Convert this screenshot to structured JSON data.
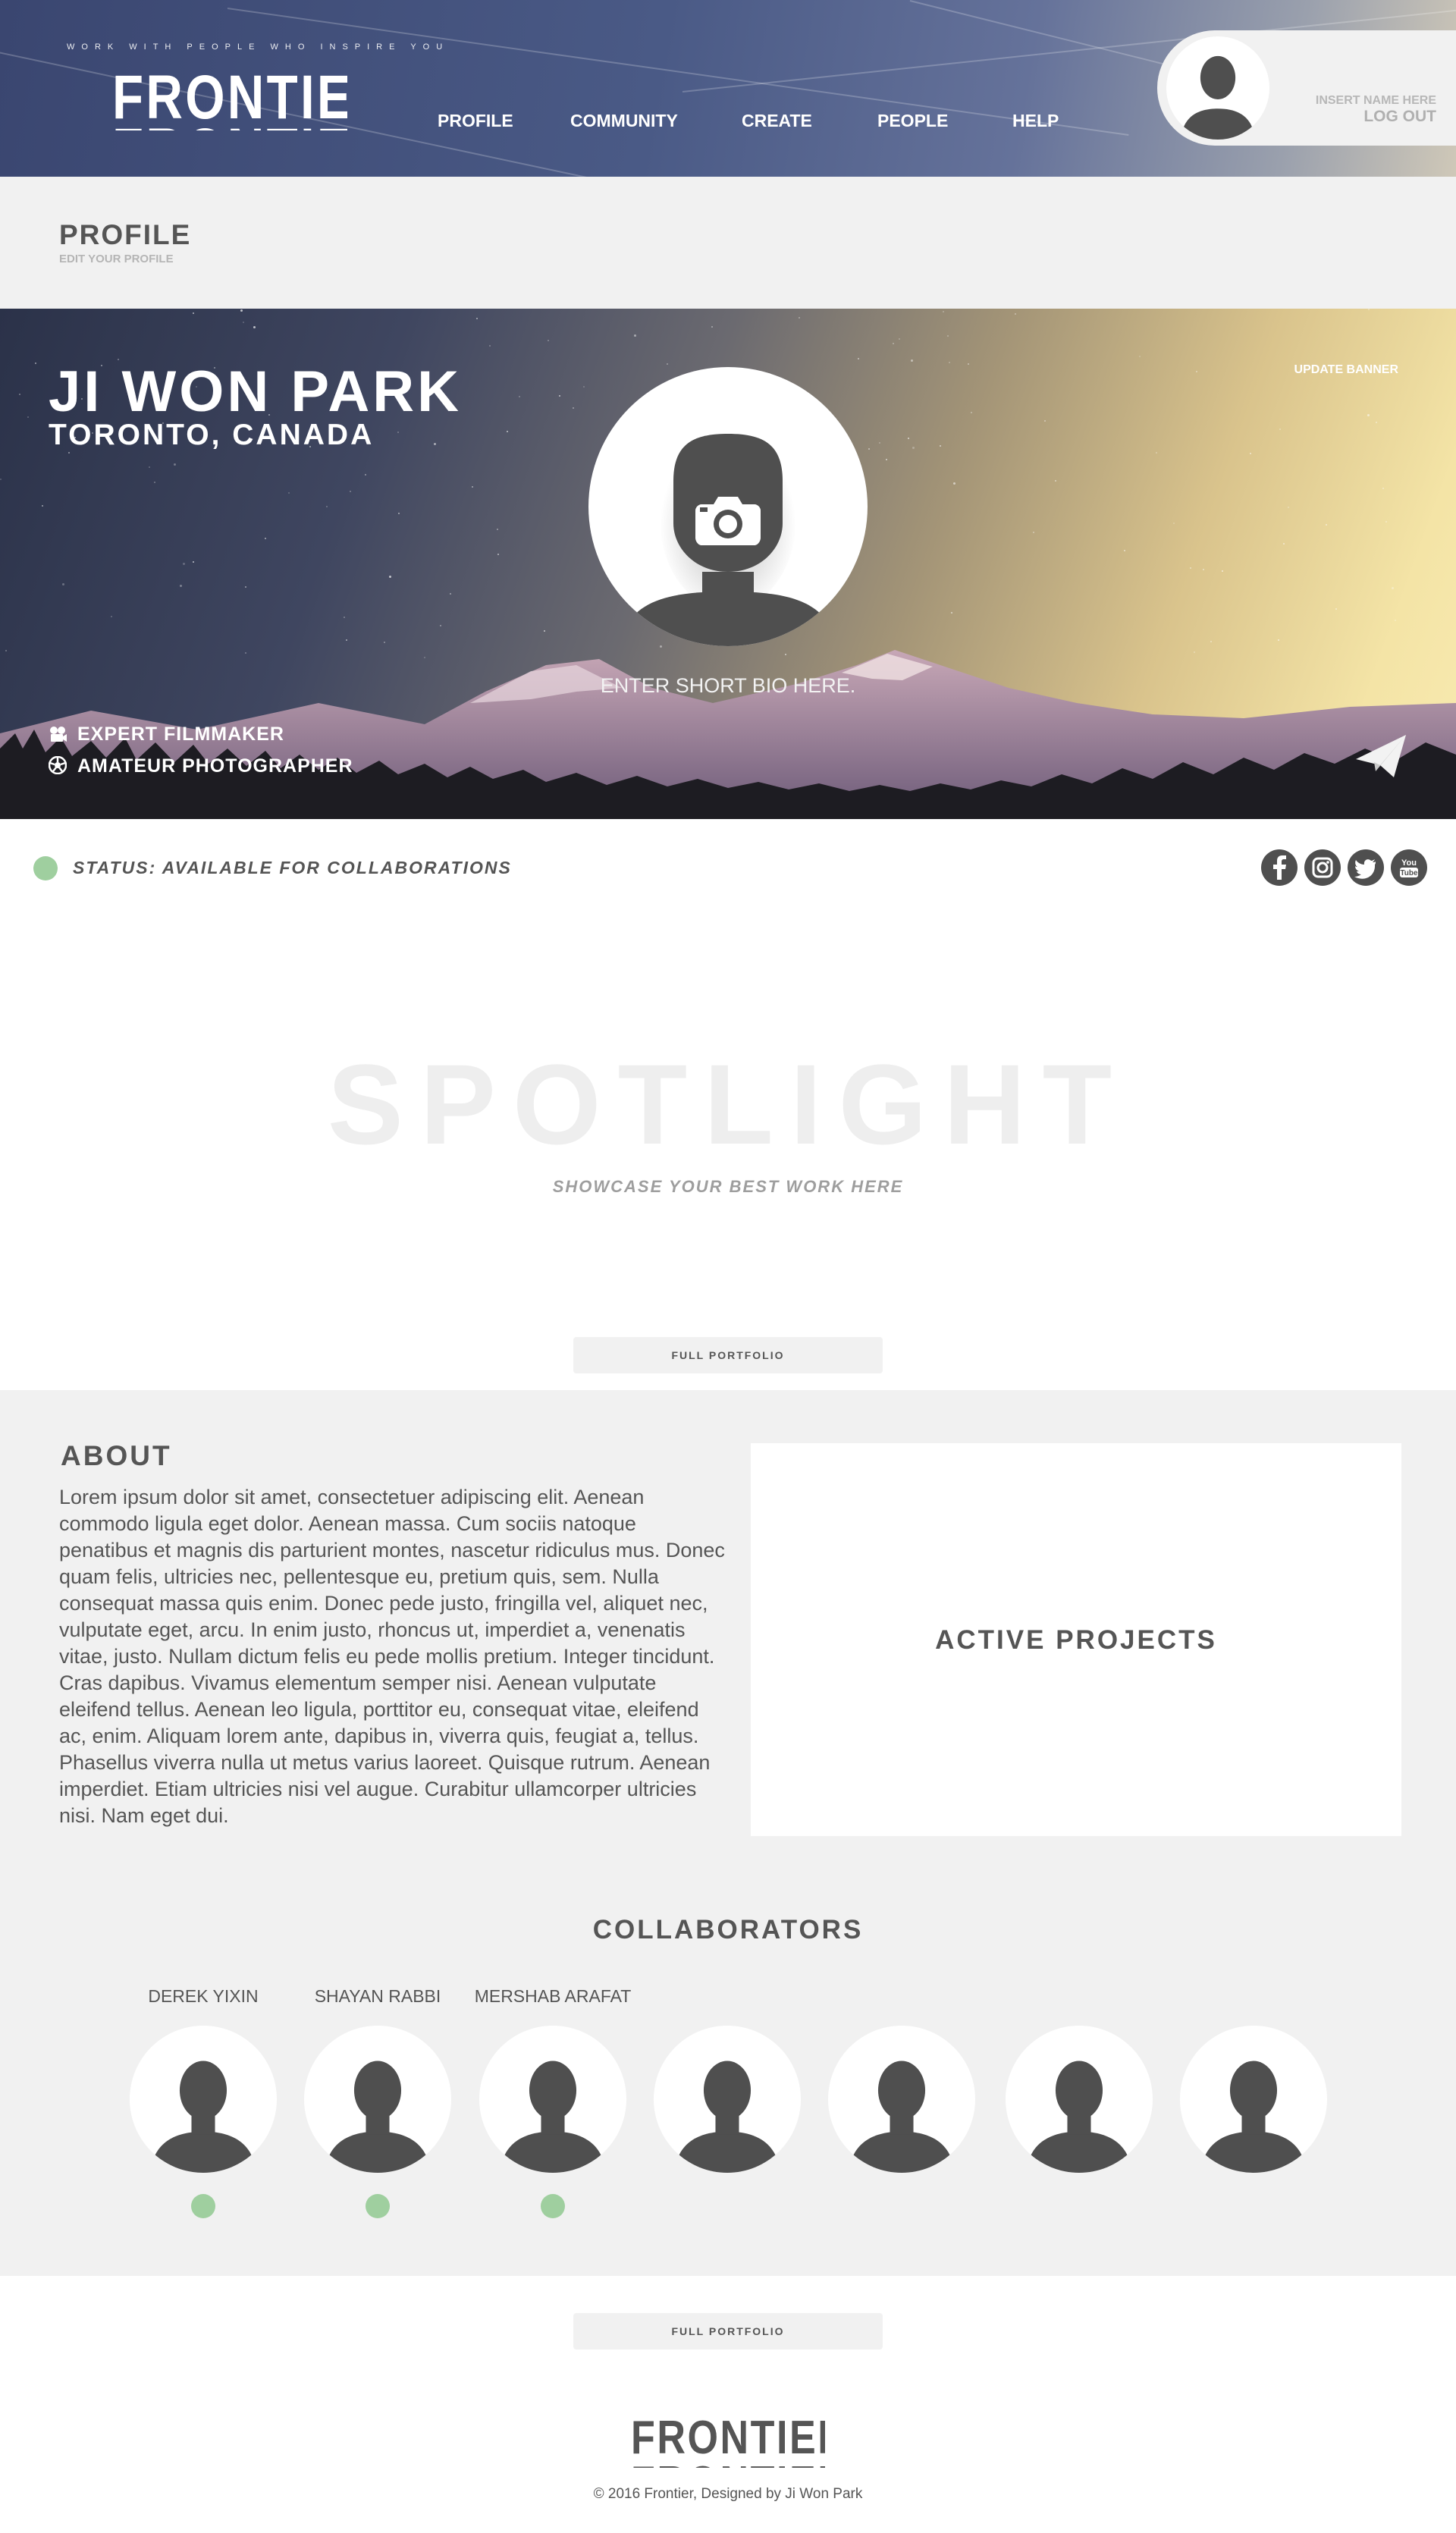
{
  "header": {
    "tagline": "WORK WITH PEOPLE WHO INSPIRE YOU",
    "logo": "FRONTIER",
    "nav": [
      {
        "label": "PROFILE"
      },
      {
        "label": "COMMUNITY"
      },
      {
        "label": "CREATE"
      },
      {
        "label": "PEOPLE"
      },
      {
        "label": "HELP"
      }
    ],
    "user": {
      "name_placeholder": "INSERT NAME HERE",
      "logout": "LOG OUT"
    }
  },
  "profile_bar": {
    "title": "PROFILE",
    "subtitle": "EDIT YOUR PROFILE"
  },
  "banner": {
    "name": "JI WON PARK",
    "location": "TORONTO, CANADA",
    "update_banner": "UPDATE BANNER",
    "bio": "ENTER SHORT BIO HERE.",
    "skills": [
      {
        "label": "EXPERT FILMMAKER",
        "icon": "film-camera-icon"
      },
      {
        "label": "AMATEUR PHOTOGRAPHER",
        "icon": "aperture-icon"
      }
    ],
    "send_icon": "paper-plane-icon"
  },
  "status": {
    "text": "STATUS: AVAILABLE FOR COLLABORATIONS",
    "color": "#9fcf9f"
  },
  "social": [
    {
      "name": "facebook-icon",
      "glyph": "f"
    },
    {
      "name": "instagram-icon",
      "glyph": ""
    },
    {
      "name": "twitter-icon",
      "glyph": ""
    },
    {
      "name": "youtube-icon",
      "glyph": "You\nTube"
    }
  ],
  "spotlight": {
    "title": "SPOTLIGHT",
    "subtitle": "SHOWCASE YOUR BEST WORK HERE"
  },
  "portfolio_button": "FULL PORTFOLIO",
  "about": {
    "title": "ABOUT",
    "text": "Lorem ipsum dolor sit amet, consectetuer adipiscing elit. Aenean commodo ligula eget dolor. Aenean massa. Cum sociis natoque penatibus et magnis dis parturient montes, nascetur ridiculus mus. Donec quam felis, ultricies nec, pellentesque eu, pretium quis, sem. Nulla consequat massa quis enim. Donec pede justo, fringilla vel, aliquet nec, vulputate eget, arcu. In enim justo, rhoncus ut, imperdiet a, venenatis vitae, justo. Nullam dictum felis eu pede mollis pretium. Integer tincidunt. Cras dapibus. Vivamus elementum semper nisi. Aenean vulputate eleifend tellus. Aenean leo ligula, porttitor eu, consequat vitae, eleifend ac, enim. Aliquam lorem ante, dapibus in, viverra quis, feugiat a, tellus. Phasellus viverra nulla ut metus varius laoreet. Quisque rutrum. Aenean imperdiet. Etiam ultricies nisi vel augue. Curabitur ullamcorper ultricies nisi. Nam eget dui."
  },
  "projects": {
    "title": "ACTIVE PROJECTS"
  },
  "collaborators": {
    "title": "COLLABORATORS",
    "people": [
      {
        "name": "DEREK YIXIN",
        "online": true
      },
      {
        "name": "SHAYAN RABBI",
        "online": true
      },
      {
        "name": "MERSHAB ARAFAT",
        "online": true
      },
      {
        "name": "",
        "online": false
      },
      {
        "name": "",
        "online": false
      },
      {
        "name": "",
        "online": false
      },
      {
        "name": "",
        "online": false
      }
    ]
  },
  "footer": {
    "logo": "FRONTIER",
    "copyright": "© 2016 Frontier, Designed by Ji Won Park"
  }
}
